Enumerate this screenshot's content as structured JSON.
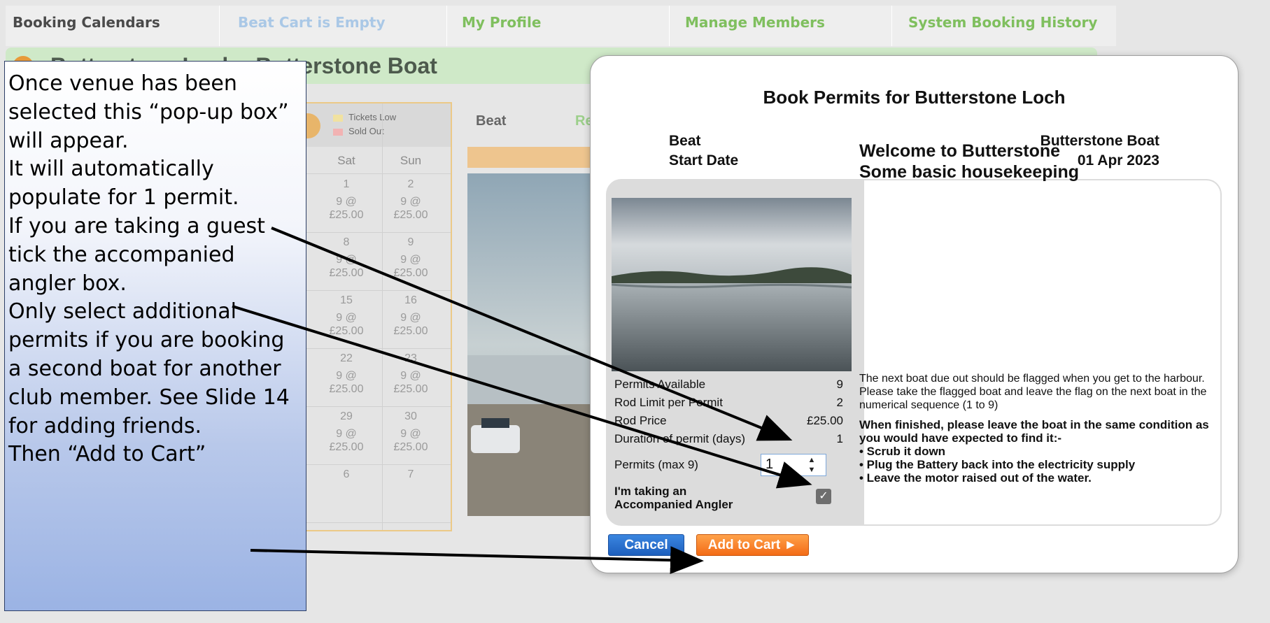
{
  "nav": {
    "items": [
      {
        "label": "Booking Calendars",
        "color": "#4a4a4a"
      },
      {
        "label": "Beat Cart is Empty",
        "color": "#aac8e6"
      },
      {
        "label": "My Profile",
        "color": "#7fbf5e"
      },
      {
        "label": "Manage Members",
        "color": "#7fbf5e"
      },
      {
        "label": "System Booking History",
        "color": "#7fbf5e"
      }
    ]
  },
  "venue": {
    "title": "Butterstone Loch - Butterstone Boat"
  },
  "calendar": {
    "legend": {
      "low": "Tickets Low",
      "sold": "Sold Out"
    },
    "days": [
      "Sat",
      "Sun"
    ],
    "rows": [
      {
        "sat": "1",
        "sun": "2",
        "sat_info": "9 @\n£25.00",
        "sun_info": "9 @\n£25.00"
      },
      {
        "sat": "8",
        "sun": "9",
        "sat_info": "9 @\n£25.00",
        "sun_info": "9 @\n£25.00"
      },
      {
        "sat": "15",
        "sun": "16",
        "sat_info": "9 @\n£25.00",
        "sun_info": "9 @\n£25.00"
      },
      {
        "sat": "22",
        "sun": "23",
        "sat_info": "9 @\n£25.00",
        "sun_info": "9 @\n£25.00"
      },
      {
        "sat": "29",
        "sun": "30",
        "sat_info": "9 @\n£25.00",
        "sun_info": "9 @\n£25.00"
      },
      {
        "sat": "6",
        "sun": "7",
        "sat_info": "",
        "sun_info": ""
      }
    ],
    "left_partial": "0"
  },
  "beat_column": {
    "beat": "Beat",
    "res": "Re"
  },
  "annotation": {
    "text": "Once venue has been selected this “pop-up box” will appear.\nIt will automatically populate for 1 permit.\nIf you are taking a guest tick the accompanied angler box.\nOnly select additional permits if you are booking a second boat for another club member. See Slide 14 for adding friends.\nThen “Add to Cart”"
  },
  "modal": {
    "title": "Book Permits for Butterstone Loch",
    "beat_label": "Beat",
    "beat_value": "Butterstone Boat",
    "start_label": "Start Date",
    "start_value": "01 Apr 2023",
    "details": [
      {
        "label": "Permits Available",
        "value": "9"
      },
      {
        "label": "Rod Limit per Permit",
        "value": "2"
      },
      {
        "label": "Rod Price",
        "value": "£25.00"
      },
      {
        "label": "Duration of permit (days)",
        "value": "1"
      }
    ],
    "permits_label": "Permits (max 9)",
    "permits_value": "1",
    "accompanied_label": "I'm taking an\nAccompanied Angler",
    "accompanied_checked": true,
    "welcome_heading": "Welcome to Butterstone\nSome basic housekeeping",
    "welcome_para": "The next boat due out should be flagged when you get to the harbour. Please take the flagged boat and leave the flag on the next boat in the numerical sequence (1 to 9)",
    "welcome_bold": "When finished, please leave the boat in the same condition as you would have expected to find it:-\n• Scrub it down\n• Plug the Battery back into the electricity supply\n• Leave the motor raised out of the water.",
    "cancel_label": "Cancel",
    "add_label": "Add to Cart ►"
  },
  "colors": {
    "accent_blue": "#1d5fbd",
    "accent_orange": "#f36b16"
  }
}
